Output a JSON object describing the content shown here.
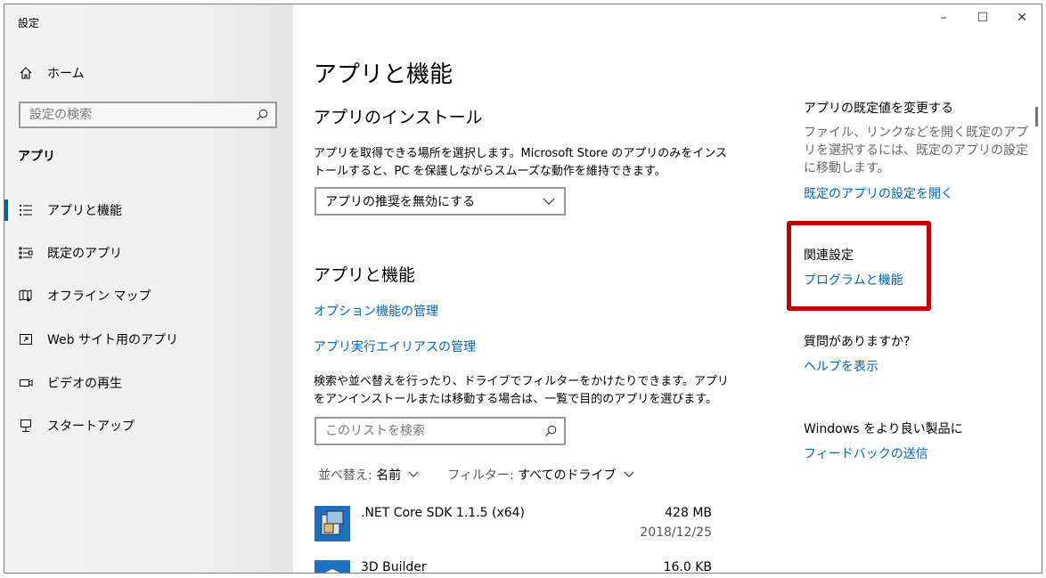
{
  "window": {
    "title": "設定",
    "controls": {
      "minimize": "–",
      "maximize": "☐",
      "close": "✕"
    }
  },
  "sidebar": {
    "home_label": "ホーム",
    "search_placeholder": "設定の検索",
    "section_label": "アプリ",
    "items": [
      {
        "label": "アプリと機能",
        "icon": "apps-features-icon",
        "selected": true
      },
      {
        "label": "既定のアプリ",
        "icon": "default-apps-icon"
      },
      {
        "label": "オフライン マップ",
        "icon": "offline-maps-icon"
      },
      {
        "label": "Web サイト用のアプリ",
        "icon": "apps-for-websites-icon"
      },
      {
        "label": "ビデオの再生",
        "icon": "video-playback-icon"
      },
      {
        "label": "スタートアップ",
        "icon": "startup-icon"
      }
    ]
  },
  "main": {
    "title": "アプリと機能",
    "install": {
      "heading": "アプリのインストール",
      "description": "アプリを取得できる場所を選択します。Microsoft Store のアプリのみをインストールすると、PC を保護しながらスムーズな動作を維持できます。",
      "dropdown_value": "アプリの推奨を無効にする"
    },
    "features": {
      "heading": "アプリと機能",
      "link_optional": "オプション機能の管理",
      "link_alias": "アプリ実行エイリアスの管理",
      "description": "検索や並べ替えを行ったり、ドライブでフィルターをかけたりできます。アプリをアンインストールまたは移動する場合は、一覧で目的のアプリを選びます。",
      "list_search_placeholder": "このリストを検索",
      "sort_label": "並べ替え:",
      "sort_value": "名前",
      "filter_label": "フィルター:",
      "filter_value": "すべてのドライブ"
    },
    "apps": [
      {
        "name": ".NET Core SDK 1.1.5 (x64)",
        "size": "428 MB",
        "date": "2018/12/25",
        "icon": "installer-icon"
      },
      {
        "name": "3D Builder",
        "size": "16.0 KB",
        "date": "",
        "icon": "3d-builder-icon"
      }
    ]
  },
  "right": {
    "defaults_heading": "アプリの既定値を変更する",
    "defaults_desc": "ファイル、リンクなどを開く既定のアプリを選択するには、既定のアプリの設定に移動します。",
    "defaults_link": "既定のアプリの設定を開く",
    "related_heading": "関連設定",
    "related_link": "プログラムと機能",
    "help_heading": "質問がありますか?",
    "help_link": "ヘルプを表示",
    "feedback_heading": "Windows をより良い製品に",
    "feedback_link": "フィードバックの送信"
  },
  "colors": {
    "accent": "#0063b1",
    "link": "#0066b4",
    "highlight": "#c00000"
  }
}
